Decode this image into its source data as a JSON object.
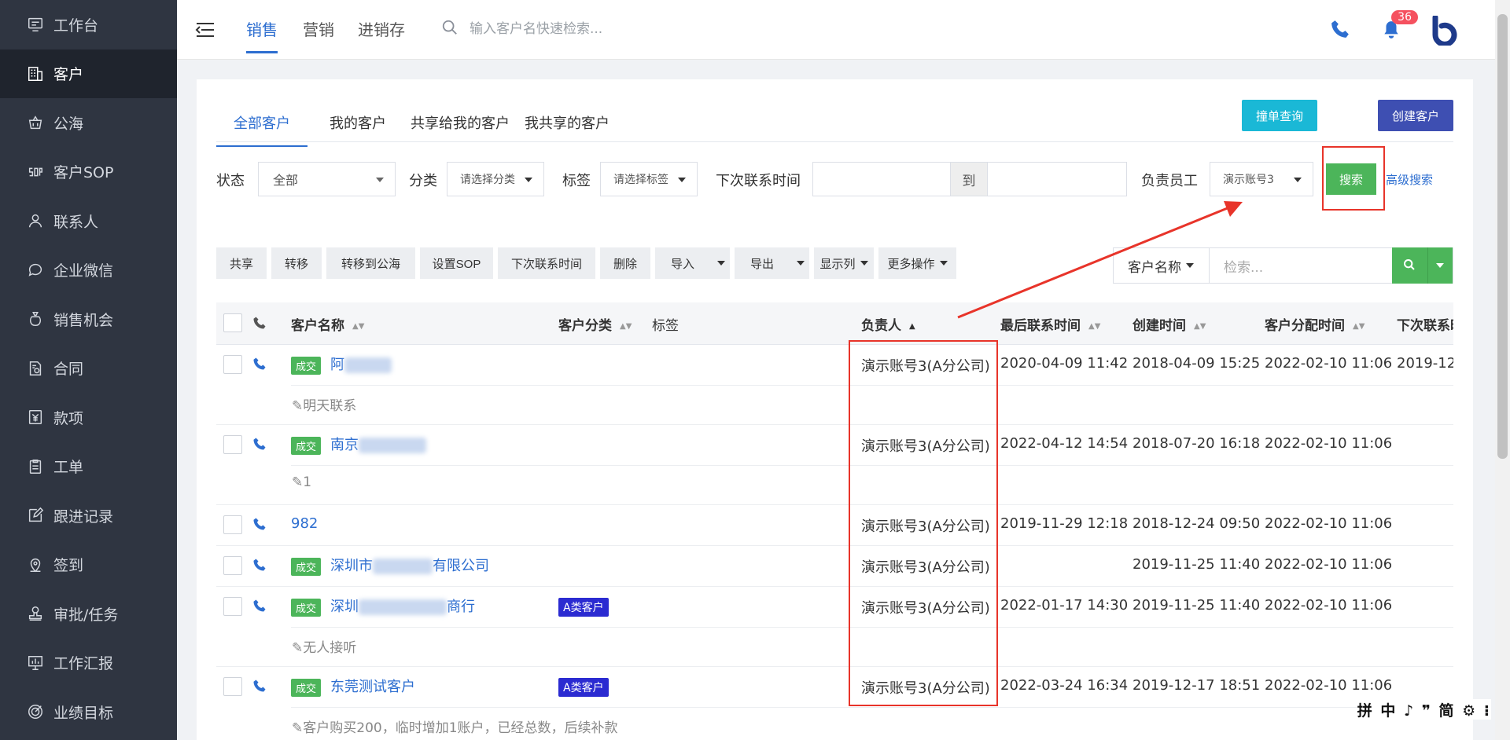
{
  "sidebar": {
    "items": [
      {
        "label": "工作台",
        "icon": "monitor-icon"
      },
      {
        "label": "客户",
        "icon": "building-icon",
        "active": true
      },
      {
        "label": "公海",
        "icon": "basket-icon"
      },
      {
        "label": "客户SOP",
        "icon": "sop-icon"
      },
      {
        "label": "联系人",
        "icon": "person-icon"
      },
      {
        "label": "企业微信",
        "icon": "chat-icon"
      },
      {
        "label": "销售机会",
        "icon": "moneybag-icon"
      },
      {
        "label": "合同",
        "icon": "contract-icon"
      },
      {
        "label": "款项",
        "icon": "yen-icon"
      },
      {
        "label": "工单",
        "icon": "clipboard-icon"
      },
      {
        "label": "跟进记录",
        "icon": "edit-icon"
      },
      {
        "label": "签到",
        "icon": "location-icon"
      },
      {
        "label": "审批/任务",
        "icon": "stamp-icon"
      },
      {
        "label": "工作汇报",
        "icon": "report-icon"
      },
      {
        "label": "业绩目标",
        "icon": "target-icon"
      }
    ]
  },
  "topbar": {
    "tabs": [
      "销售",
      "营销",
      "进销存"
    ],
    "search_placeholder": "输入客户名快速检索...",
    "notification_count": "36",
    "accent": "#2d6ed0"
  },
  "card": {
    "tabs": [
      "全部客户",
      "我的客户",
      "共享给我的客户",
      "我共享的客户"
    ],
    "btn_dup_query": "撞单查询",
    "btn_create": "创建客户"
  },
  "filters": {
    "status_label": "状态",
    "status_value": "全部",
    "category_label": "分类",
    "category_value": "请选择分类",
    "tag_label": "标签",
    "tag_value": "请选择标签",
    "next_contact_label": "下次联系时间",
    "to_label": "到",
    "owner_label": "负责员工",
    "owner_value": "演示账号3",
    "search_btn": "搜索",
    "advanced": "高级搜索"
  },
  "toolbar": {
    "buttons": [
      "共享",
      "转移",
      "转移到公海",
      "设置SOP",
      "下次联系时间",
      "删除",
      "导入",
      "导出",
      "显示列",
      "更多操作"
    ],
    "search_field": "客户名称",
    "search_placeholder": "检索..."
  },
  "table": {
    "headers": [
      "客户名称",
      "客户分类",
      "标签",
      "负责人",
      "最后联系时间",
      "创建时间",
      "客户分配时间",
      "下次联系时间"
    ],
    "deal_tag": "成交",
    "rows": [
      {
        "deal": true,
        "name_prefix": "阿",
        "category": "",
        "owner": "演示账号3(A分公司)",
        "last_contact": "2020-04-09 11:42",
        "created": "2018-04-09 15:25",
        "assigned": "2022-02-10 11:06",
        "next": "2019-12-",
        "note": "明天联系"
      },
      {
        "deal": true,
        "name_prefix": "南京",
        "category": "",
        "owner": "演示账号3(A分公司)",
        "last_contact": "2022-04-12 14:54",
        "created": "2018-07-20 16:18",
        "assigned": "2022-02-10 11:06",
        "next": "",
        "note": "1"
      },
      {
        "deal": false,
        "name_prefix": "982",
        "category": "",
        "owner": "演示账号3(A分公司)",
        "last_contact": "2019-11-29 12:18",
        "created": "2018-12-24 09:50",
        "assigned": "2022-02-10 11:06",
        "next": "",
        "note": ""
      },
      {
        "deal": true,
        "name_prefix": "深圳市",
        "name_suffix": "有限公司",
        "category": "",
        "owner": "演示账号3(A分公司)",
        "last_contact": "",
        "created": "2019-11-25 11:40",
        "assigned": "2022-02-10 11:06",
        "next": "",
        "note": ""
      },
      {
        "deal": true,
        "name_prefix": "深圳",
        "name_suffix": "商行",
        "category": "A类客户",
        "owner": "演示账号3(A分公司)",
        "last_contact": "2022-01-17 14:30",
        "created": "2019-11-25 11:40",
        "assigned": "2022-02-10 11:06",
        "next": "",
        "note": "无人接听"
      },
      {
        "deal": true,
        "name_prefix": "东莞测试客户",
        "category": "A类客户",
        "owner": "演示账号3(A分公司)",
        "last_contact": "2022-03-24 16:34",
        "created": "2019-12-17 18:51",
        "assigned": "2022-02-10 11:06",
        "next": "",
        "note": "客户购买200，临时增加1账户，已经总数，后续补款"
      }
    ]
  },
  "ime": "拼 中 ♪ ❞ 简 ⚙ ⁝"
}
